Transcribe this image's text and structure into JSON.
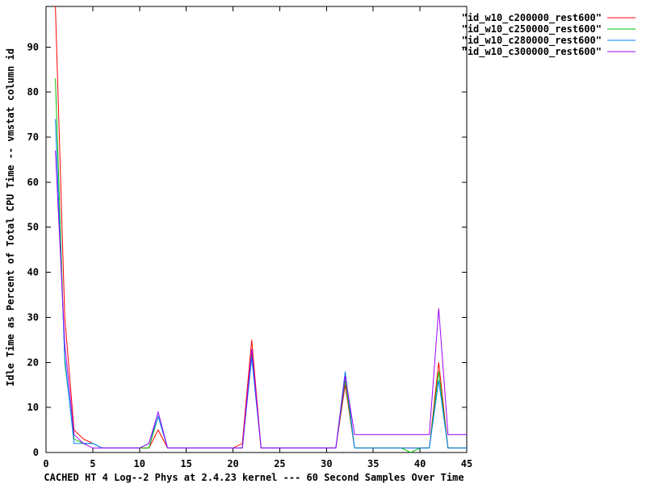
{
  "chart_data": {
    "type": "line",
    "title": "",
    "xlabel": "CACHED HT 4 Log--2 Phys at 2.4.23 kernel --- 60 Second Samples Over Time",
    "ylabel": "Idle Time as Percent of Total CPU Time -- vmstat column id",
    "xlim": [
      0,
      45
    ],
    "ylim": [
      0,
      99
    ],
    "xticks": [
      0,
      5,
      10,
      15,
      20,
      25,
      30,
      35,
      40,
      45
    ],
    "yticks": [
      0,
      10,
      20,
      30,
      40,
      50,
      60,
      70,
      80,
      90
    ],
    "grid": false,
    "legend_position": "top-right",
    "series": [
      {
        "name": "\"id_w10_c200000_rest600\"",
        "color": "#ff0000",
        "points": [
          [
            1,
            99
          ],
          [
            2,
            30
          ],
          [
            3,
            5
          ],
          [
            4,
            3
          ],
          [
            5,
            2
          ],
          [
            6,
            1
          ],
          [
            7,
            1
          ],
          [
            8,
            1
          ],
          [
            9,
            1
          ],
          [
            10,
            1
          ],
          [
            11,
            1
          ],
          [
            12,
            5
          ],
          [
            13,
            1
          ],
          [
            14,
            1
          ],
          [
            15,
            1
          ],
          [
            16,
            1
          ],
          [
            17,
            1
          ],
          [
            18,
            1
          ],
          [
            19,
            1
          ],
          [
            20,
            1
          ],
          [
            21,
            2
          ],
          [
            22,
            25
          ],
          [
            23,
            1
          ],
          [
            24,
            1
          ],
          [
            25,
            1
          ],
          [
            26,
            1
          ],
          [
            27,
            1
          ],
          [
            28,
            1
          ],
          [
            29,
            1
          ],
          [
            30,
            1
          ],
          [
            31,
            1
          ],
          [
            32,
            15
          ],
          [
            33,
            1
          ],
          [
            34,
            1
          ],
          [
            35,
            1
          ],
          [
            36,
            1
          ],
          [
            37,
            1
          ],
          [
            38,
            1
          ],
          [
            39,
            1
          ],
          [
            40,
            1
          ],
          [
            41,
            1
          ],
          [
            42,
            20
          ],
          [
            43,
            1
          ],
          [
            44,
            1
          ],
          [
            45,
            1
          ]
        ]
      },
      {
        "name": "\"id_w10_c250000_rest600\"",
        "color": "#00c000",
        "points": [
          [
            1,
            83
          ],
          [
            2,
            20
          ],
          [
            3,
            3
          ],
          [
            4,
            2
          ],
          [
            5,
            2
          ],
          [
            6,
            1
          ],
          [
            7,
            1
          ],
          [
            8,
            1
          ],
          [
            9,
            1
          ],
          [
            10,
            1
          ],
          [
            11,
            1
          ],
          [
            12,
            8
          ],
          [
            13,
            1
          ],
          [
            14,
            1
          ],
          [
            15,
            1
          ],
          [
            16,
            1
          ],
          [
            17,
            1
          ],
          [
            18,
            1
          ],
          [
            19,
            1
          ],
          [
            20,
            1
          ],
          [
            21,
            1
          ],
          [
            22,
            22
          ],
          [
            23,
            1
          ],
          [
            24,
            1
          ],
          [
            25,
            1
          ],
          [
            26,
            1
          ],
          [
            27,
            1
          ],
          [
            28,
            1
          ],
          [
            29,
            1
          ],
          [
            30,
            1
          ],
          [
            31,
            1
          ],
          [
            32,
            16
          ],
          [
            33,
            1
          ],
          [
            34,
            1
          ],
          [
            35,
            1
          ],
          [
            36,
            1
          ],
          [
            37,
            1
          ],
          [
            38,
            1
          ],
          [
            39,
            0
          ],
          [
            40,
            1
          ],
          [
            41,
            1
          ],
          [
            42,
            18
          ],
          [
            43,
            1
          ],
          [
            44,
            1
          ],
          [
            45,
            1
          ]
        ]
      },
      {
        "name": "\"id_w10_c280000_rest600\"",
        "color": "#0080ff",
        "points": [
          [
            1,
            74
          ],
          [
            2,
            21
          ],
          [
            3,
            2
          ],
          [
            4,
            2
          ],
          [
            5,
            2
          ],
          [
            6,
            1
          ],
          [
            7,
            1
          ],
          [
            8,
            1
          ],
          [
            9,
            1
          ],
          [
            10,
            1
          ],
          [
            11,
            2
          ],
          [
            12,
            8
          ],
          [
            13,
            1
          ],
          [
            14,
            1
          ],
          [
            15,
            1
          ],
          [
            16,
            1
          ],
          [
            17,
            1
          ],
          [
            18,
            1
          ],
          [
            19,
            1
          ],
          [
            20,
            1
          ],
          [
            21,
            1
          ],
          [
            22,
            21
          ],
          [
            23,
            1
          ],
          [
            24,
            1
          ],
          [
            25,
            1
          ],
          [
            26,
            1
          ],
          [
            27,
            1
          ],
          [
            28,
            1
          ],
          [
            29,
            1
          ],
          [
            30,
            1
          ],
          [
            31,
            1
          ],
          [
            32,
            18
          ],
          [
            33,
            1
          ],
          [
            34,
            1
          ],
          [
            35,
            1
          ],
          [
            36,
            1
          ],
          [
            37,
            1
          ],
          [
            38,
            1
          ],
          [
            39,
            1
          ],
          [
            40,
            1
          ],
          [
            41,
            1
          ],
          [
            42,
            16
          ],
          [
            43,
            1
          ],
          [
            44,
            1
          ],
          [
            45,
            1
          ]
        ]
      },
      {
        "name": "\"id_w10_c300000_rest600\"",
        "color": "#a000ff",
        "points": [
          [
            1,
            67
          ],
          [
            2,
            24
          ],
          [
            3,
            4
          ],
          [
            4,
            2
          ],
          [
            5,
            1
          ],
          [
            6,
            1
          ],
          [
            7,
            1
          ],
          [
            8,
            1
          ],
          [
            9,
            1
          ],
          [
            10,
            1
          ],
          [
            11,
            2
          ],
          [
            12,
            9
          ],
          [
            13,
            1
          ],
          [
            14,
            1
          ],
          [
            15,
            1
          ],
          [
            16,
            1
          ],
          [
            17,
            1
          ],
          [
            18,
            1
          ],
          [
            19,
            1
          ],
          [
            20,
            1
          ],
          [
            21,
            1
          ],
          [
            22,
            23
          ],
          [
            23,
            1
          ],
          [
            24,
            1
          ],
          [
            25,
            1
          ],
          [
            26,
            1
          ],
          [
            27,
            1
          ],
          [
            28,
            1
          ],
          [
            29,
            1
          ],
          [
            30,
            1
          ],
          [
            31,
            1
          ],
          [
            32,
            17
          ],
          [
            33,
            4
          ],
          [
            34,
            4
          ],
          [
            35,
            4
          ],
          [
            36,
            4
          ],
          [
            37,
            4
          ],
          [
            38,
            4
          ],
          [
            39,
            4
          ],
          [
            40,
            4
          ],
          [
            41,
            4
          ],
          [
            42,
            32
          ],
          [
            43,
            4
          ],
          [
            44,
            4
          ],
          [
            45,
            4
          ]
        ]
      }
    ]
  }
}
